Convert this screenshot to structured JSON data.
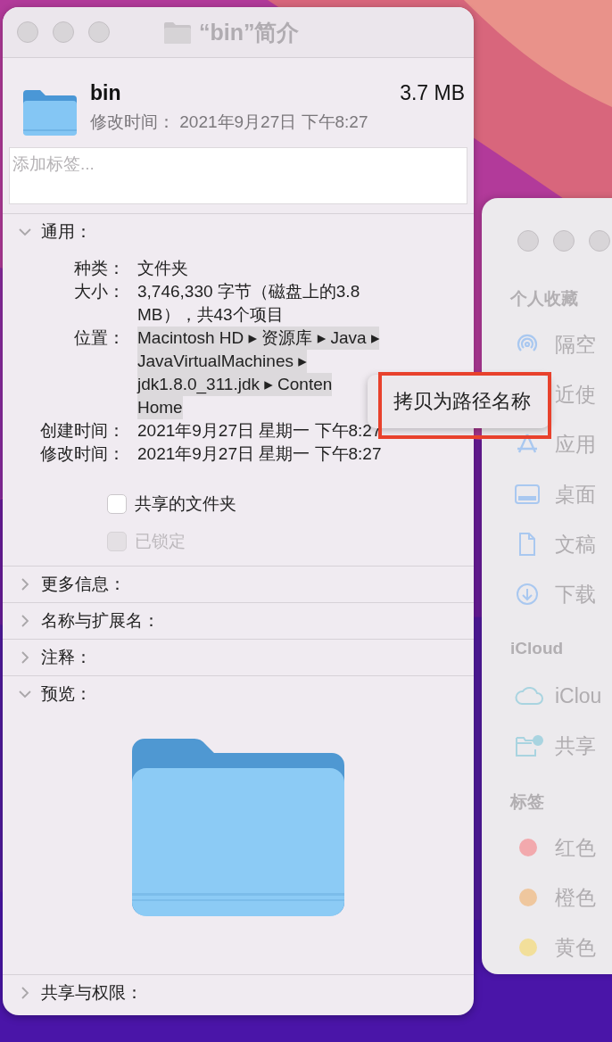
{
  "info_window": {
    "title": "“bin”简介",
    "name": "bin",
    "size": "3.7 MB",
    "modified": "修改时间： 2021年9月27日 下午8:27",
    "tags_field": {
      "placeholder": "添加标签..."
    },
    "sections": [
      {
        "title": "通用：",
        "expanded": true,
        "kind": "general"
      },
      {
        "title": "更多信息：",
        "expanded": false,
        "kind": "plain"
      },
      {
        "title": "名称与扩展名：",
        "expanded": false,
        "kind": "plain"
      },
      {
        "title": "注释：",
        "expanded": false,
        "kind": "plain"
      },
      {
        "title": "预览：",
        "expanded": true,
        "kind": "preview"
      },
      {
        "title": "共享与权限：",
        "expanded": false,
        "kind": "plain"
      }
    ],
    "general": {
      "fields": [
        {
          "label": "种类：",
          "lines": [
            "文件夹"
          ],
          "kind": "text"
        },
        {
          "label": "大小：",
          "lines": [
            "3,746,330 字节（磁盘上的3.8",
            "MB），共43个项目"
          ],
          "kind": "text"
        },
        {
          "label": "位置：",
          "lines": [
            "Macintosh HD ▸ 资源库 ▸ Java ▸",
            "JavaVirtualMachines ▸",
            "jdk1.8.0_311.jdk ▸ Conten",
            "Home"
          ],
          "kind": "path"
        },
        {
          "label": "创建时间：",
          "lines": [
            "2021年9月27日 星期一 下午8:27"
          ],
          "kind": "text"
        },
        {
          "label": "修改时间：",
          "lines": [
            "2021年9月27日 星期一 下午8:27"
          ],
          "kind": "text"
        }
      ],
      "checkboxes": [
        {
          "label": "共享的文件夹",
          "checked": false,
          "disabled": false
        },
        {
          "label": "已锁定",
          "checked": false,
          "disabled": true
        }
      ]
    }
  },
  "context_menu": {
    "items": [
      {
        "label": "拷贝为路径名称",
        "outlined": true
      }
    ]
  },
  "finder_sidebar": {
    "groups": [
      {
        "title": "个人收藏",
        "items": [
          {
            "label": "隔空",
            "kind": "airdrop"
          },
          {
            "label": "近使",
            "kind": "none"
          },
          {
            "label": "应用",
            "kind": "apps"
          },
          {
            "label": "桌面",
            "kind": "desktop"
          },
          {
            "label": "文稿",
            "kind": "document"
          },
          {
            "label": "下载",
            "kind": "download"
          }
        ]
      },
      {
        "title": "iCloud",
        "items": [
          {
            "label": "iClou",
            "kind": "cloud"
          },
          {
            "label": "共享",
            "kind": "shared"
          }
        ]
      },
      {
        "title": "标签",
        "items": [
          {
            "label": "红色",
            "kind": "tag",
            "color": "#f2a9ad"
          },
          {
            "label": "橙色",
            "kind": "tag",
            "color": "#efc79e"
          },
          {
            "label": "黄色",
            "kind": "tag",
            "color": "#f2df9a"
          }
        ]
      }
    ]
  }
}
